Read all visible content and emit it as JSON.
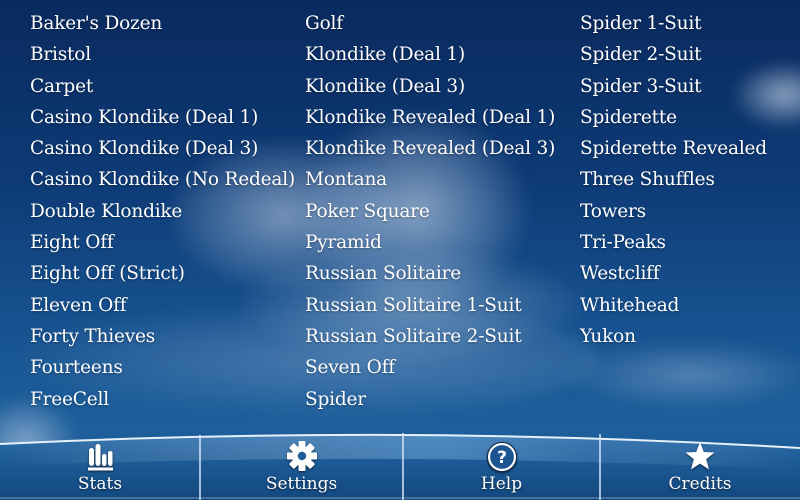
{
  "games": {
    "column_1": [
      "Baker's Dozen",
      "Bristol",
      "Carpet",
      "Casino Klondike (Deal 1)",
      "Casino Klondike (Deal 3)",
      "Casino Klondike (No Redeal)",
      "Double Klondike",
      "Eight Off",
      "Eight Off (Strict)",
      "Eleven Off",
      "Forty Thieves",
      "Fourteens",
      "FreeCell"
    ],
    "column_2": [
      "Golf",
      "Klondike (Deal 1)",
      "Klondike (Deal 3)",
      "Klondike Revealed (Deal 1)",
      "Klondike Revealed (Deal 3)",
      "Montana",
      "Poker Square",
      "Pyramid",
      "Russian Solitaire",
      "Russian Solitaire 1-Suit",
      "Russian Solitaire 2-Suit",
      "Seven Off",
      "Spider"
    ],
    "column_3": [
      "Spider 1-Suit",
      "Spider 2-Suit",
      "Spider 3-Suit",
      "Spiderette",
      "Spiderette Revealed",
      "Three Shuffles",
      "Towers",
      "Tri-Peaks",
      "Westcliff",
      "Whitehead",
      "Yukon"
    ]
  },
  "toolbar": {
    "stats": {
      "label": "Stats",
      "icon": "bar-chart-icon"
    },
    "settings": {
      "label": "Settings",
      "icon": "gear-icon"
    },
    "help": {
      "label": "Help",
      "icon": "question-circle-icon"
    },
    "credits": {
      "label": "Credits",
      "icon": "star-icon"
    }
  },
  "colors": {
    "sky_top": "#0a2a5e",
    "sky_bottom": "#1d5f9c",
    "text": "#ffffff",
    "toolbar": "#1a5a95"
  }
}
